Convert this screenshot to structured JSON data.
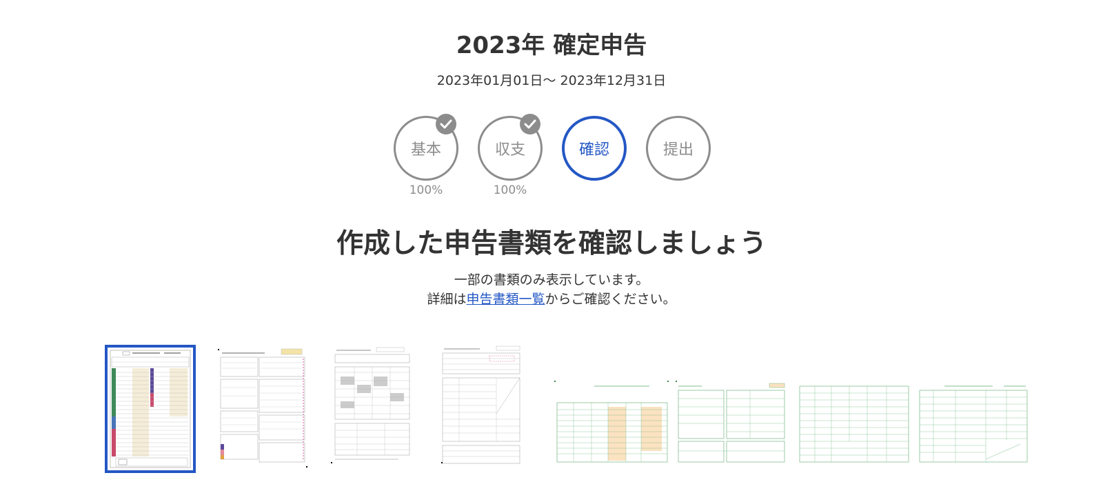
{
  "header": {
    "title": "2023年 確定申告",
    "period": "2023年01月01日～ 2023年12月31日"
  },
  "steps": [
    {
      "label": "基本",
      "percent": "100%",
      "done": true,
      "active": false
    },
    {
      "label": "収支",
      "percent": "100%",
      "done": true,
      "active": false
    },
    {
      "label": "確認",
      "percent": "",
      "done": false,
      "active": true
    },
    {
      "label": "提出",
      "percent": "",
      "done": false,
      "active": false
    }
  ],
  "main": {
    "heading": "作成した申告書類を確認しましょう",
    "note_line1": "一部の書類のみ表示しています。",
    "note_prefix": "詳細は",
    "note_link": "申告書類一覧",
    "note_suffix": "からご確認ください。"
  },
  "thumbnails": {
    "selected_index": 0,
    "count": 8
  },
  "colors": {
    "accent": "#2457c5",
    "inactive": "#8c8c8c",
    "form_green": "#5aa86a",
    "text": "#333333"
  }
}
